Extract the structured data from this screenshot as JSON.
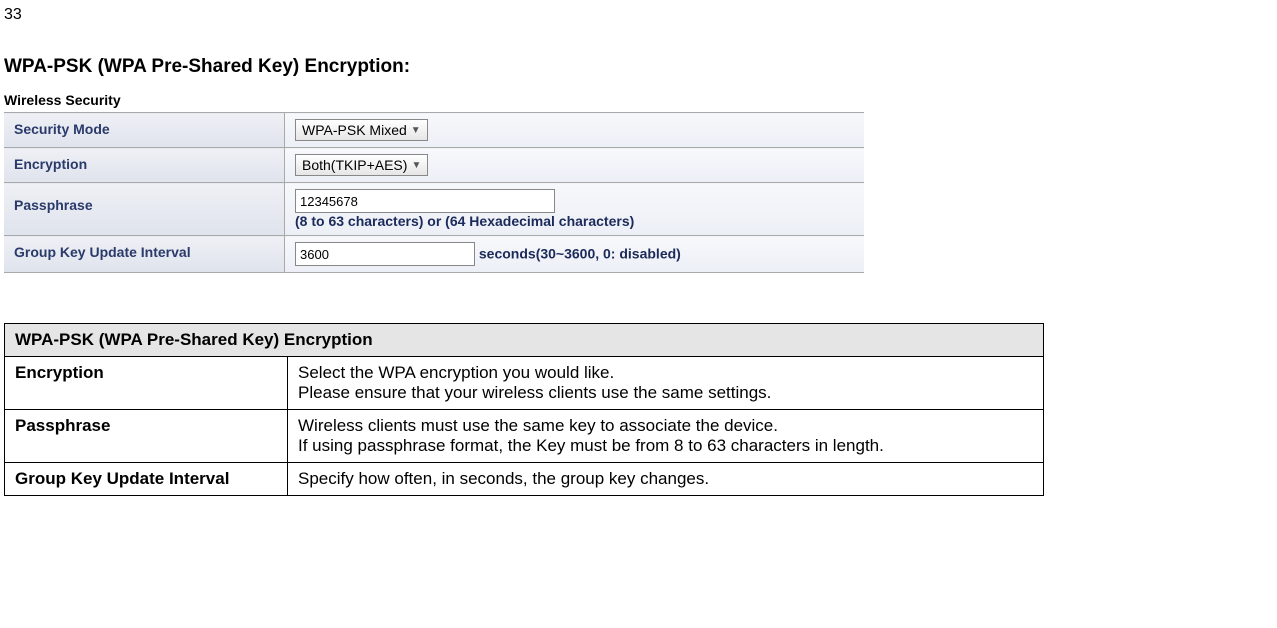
{
  "page_number": "33",
  "heading": "WPA-PSK (WPA Pre-Shared Key) Encryption:",
  "panel": {
    "title": "Wireless Security",
    "rows": {
      "security_mode": {
        "label": "Security Mode",
        "value": "WPA-PSK Mixed"
      },
      "encryption": {
        "label": "Encryption",
        "value": "Both(TKIP+AES)"
      },
      "passphrase": {
        "label": "Passphrase",
        "value": "12345678",
        "hint": "(8 to 63 characters) or (64 Hexadecimal characters)"
      },
      "group_key": {
        "label": "Group Key Update Interval",
        "value": "3600",
        "hint": "seconds(30~3600, 0: disabled)"
      }
    }
  },
  "desc": {
    "header": "WPA-PSK (WPA Pre-Shared Key) Encryption",
    "rows": [
      {
        "label": "Encryption",
        "text1": "Select the WPA encryption you would like.",
        "text2": "Please ensure that your wireless clients use the same settings."
      },
      {
        "label": "Passphrase",
        "text1": "Wireless clients must use the same key to associate the device.",
        "text2": "If using passphrase format, the Key must be from 8 to 63 characters in length."
      },
      {
        "label": "Group Key Update Interval",
        "text1": "Specify how often, in seconds, the group key changes.",
        "text2": ""
      }
    ]
  }
}
